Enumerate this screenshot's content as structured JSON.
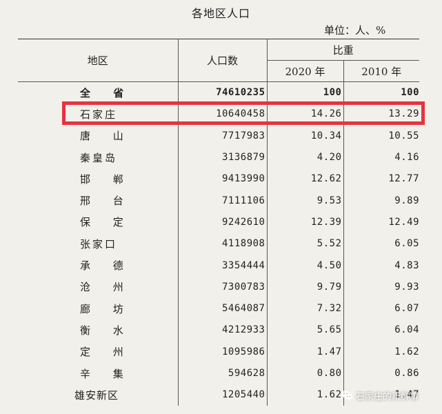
{
  "title": "各地区人口",
  "unit": "单位：人、%",
  "headers": {
    "region": "地区",
    "population": "人口数",
    "ratio": "比重",
    "year1": "2020 年",
    "year2": "2010 年"
  },
  "rows": [
    {
      "region": "全 省",
      "population": "74610235",
      "y2020": "100",
      "y2010": "100"
    },
    {
      "region": "石家庄",
      "population": "10640458",
      "y2020": "14.26",
      "y2010": "13.29"
    },
    {
      "region": "唐 山",
      "population": "7717983",
      "y2020": "10.34",
      "y2010": "10.55"
    },
    {
      "region": "秦皇岛",
      "population": "3136879",
      "y2020": "4.20",
      "y2010": "4.16"
    },
    {
      "region": "邯 郸",
      "population": "9413990",
      "y2020": "12.62",
      "y2010": "12.77"
    },
    {
      "region": "邢 台",
      "population": "7111106",
      "y2020": "9.53",
      "y2010": "9.89"
    },
    {
      "region": "保 定",
      "population": "9242610",
      "y2020": "12.39",
      "y2010": "12.49"
    },
    {
      "region": "张家口",
      "population": "4118908",
      "y2020": "5.52",
      "y2010": "6.05"
    },
    {
      "region": "承 德",
      "population": "3354444",
      "y2020": "4.50",
      "y2010": "4.83"
    },
    {
      "region": "沧 州",
      "population": "7300783",
      "y2020": "9.79",
      "y2010": "9.93"
    },
    {
      "region": "廊 坊",
      "population": "5464087",
      "y2020": "7.32",
      "y2010": "6.07"
    },
    {
      "region": "衡 水",
      "population": "4212933",
      "y2020": "5.65",
      "y2010": "6.04"
    },
    {
      "region": "定 州",
      "population": "1095986",
      "y2020": "1.47",
      "y2010": "1.62"
    },
    {
      "region": "辛 集",
      "population": "594628",
      "y2020": "0.80",
      "y2010": "0.86"
    },
    {
      "region": "雄安新区",
      "population": "1205440",
      "y2020": "1.62",
      "y2010": "1.47"
    }
  ],
  "watermark": "石家庄的新鲜事",
  "colors": {
    "highlight": "#e8323f",
    "background": "#f1f0ea"
  }
}
